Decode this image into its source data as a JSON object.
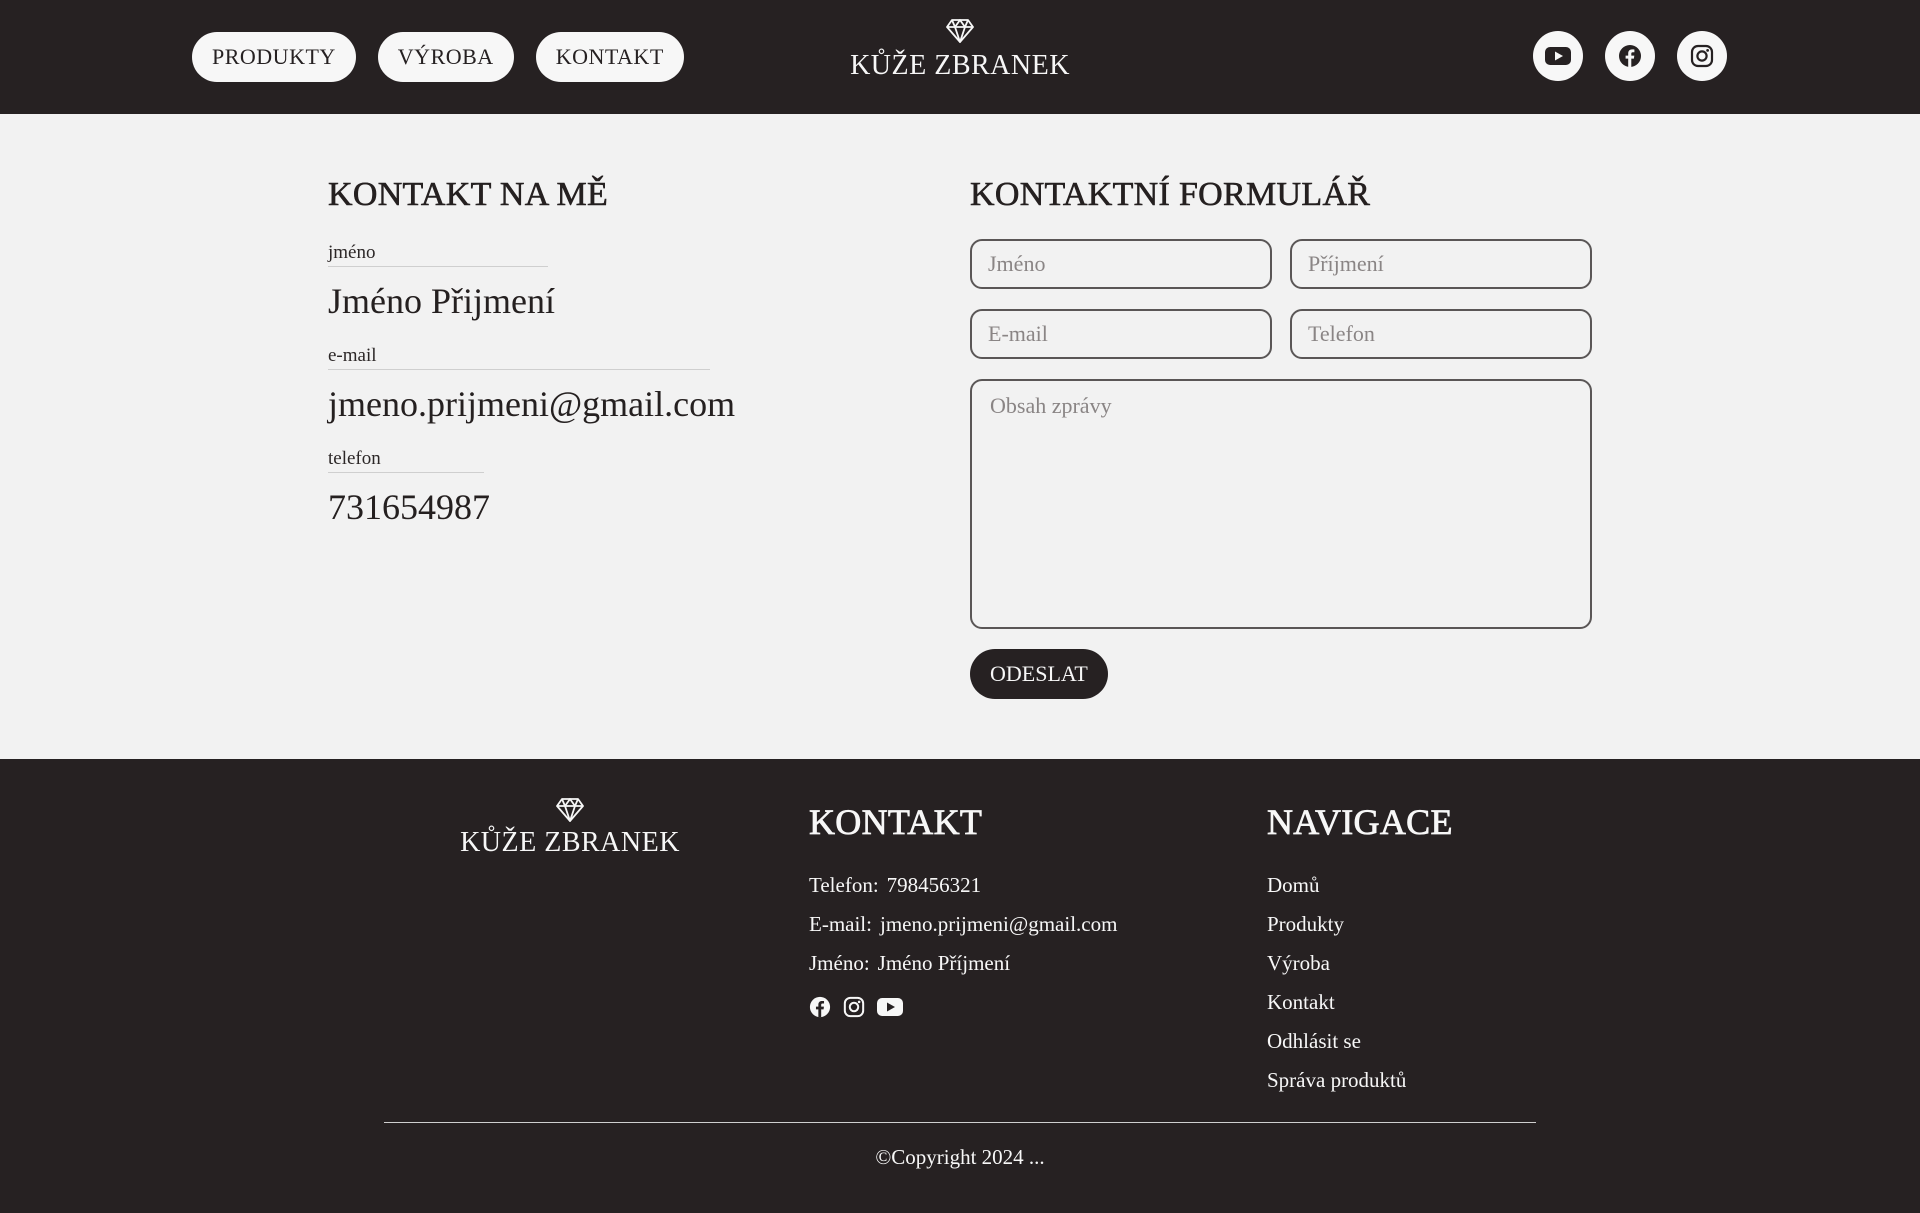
{
  "header": {
    "nav": [
      {
        "label": "PRODUKTY"
      },
      {
        "label": "VÝROBA"
      },
      {
        "label": "KONTAKT"
      }
    ],
    "brand": "KŮŽE ZBRANEK",
    "socials": [
      "youtube-icon",
      "facebook-icon",
      "instagram-icon"
    ]
  },
  "contact": {
    "title": "KONTAKT NA MĚ",
    "name_label": "jméno",
    "name_value": "Jméno Přijmení",
    "email_label": "e-mail",
    "email_value": "jmeno.prijmeni@gmail.com",
    "phone_label": "telefon",
    "phone_value": "731654987"
  },
  "form": {
    "title": "KONTAKTNÍ FORMULÁŘ",
    "first_name_placeholder": "Jméno",
    "last_name_placeholder": "Příjmení",
    "email_placeholder": "E-mail",
    "phone_placeholder": "Telefon",
    "message_placeholder": "Obsah zprávy",
    "submit_label": "ODESLAT"
  },
  "footer": {
    "brand": "KŮŽE ZBRANEK",
    "contact_heading": "KONTAKT",
    "phone_label": "Telefon:",
    "phone_value": "798456321",
    "email_label": "E-mail:",
    "email_value": "jmeno.prijmeni@gmail.com",
    "name_label": "Jméno:",
    "name_value": "Jméno Příjmení",
    "icons": [
      "facebook-icon",
      "instagram-icon",
      "youtube-icon"
    ],
    "nav_heading": "NAVIGACE",
    "nav_items": [
      {
        "label": "Domů"
      },
      {
        "label": "Produkty"
      },
      {
        "label": "Výroba"
      },
      {
        "label": "Kontakt"
      },
      {
        "label": "Odhlásit se"
      },
      {
        "label": "Správa produktů"
      }
    ],
    "copyright": "©Copyright 2024 ..."
  },
  "colors": {
    "dark": "#262122",
    "light": "#f2f2f2",
    "button_light": "#f7f7f7"
  }
}
